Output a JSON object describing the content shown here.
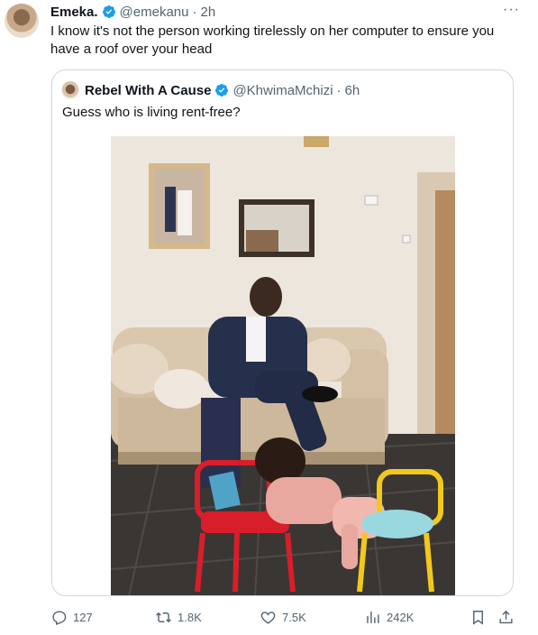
{
  "tweet": {
    "author_name": "Emeka.",
    "author_handle": "@emekanu",
    "separator": "·",
    "time": "2h",
    "more": "···",
    "text": "I know it's not the person working tirelessly on her computer to ensure you have a roof over your head"
  },
  "quoted": {
    "author_name": "Rebel With A Cause",
    "author_handle": "@KhwimaMchizi",
    "separator": "·",
    "time": "6h",
    "text": "Guess who is living rent-free?"
  },
  "actions": {
    "replies": "127",
    "reposts": "1.8K",
    "likes": "7.5K",
    "views": "242K"
  },
  "icons": {
    "verified": "verified-badge-icon",
    "reply": "reply-icon",
    "repost": "repost-icon",
    "like": "heart-icon",
    "views": "views-icon",
    "bookmark": "bookmark-icon",
    "share": "share-icon",
    "more": "more-icon"
  },
  "colors": {
    "verified_blue": "#1d9bf0",
    "secondary_text": "#536471",
    "border": "#cfd9de"
  }
}
